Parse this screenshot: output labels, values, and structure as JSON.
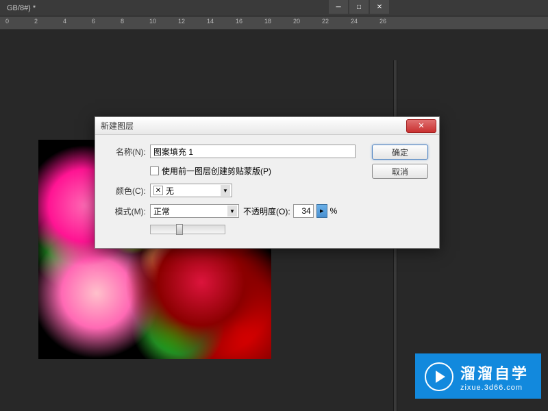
{
  "tab": {
    "label": "GB/8#) *"
  },
  "ruler": {
    "marks": [
      0,
      2,
      4,
      6,
      8,
      10,
      12,
      14,
      16,
      18,
      20,
      22,
      24,
      26
    ]
  },
  "dialog": {
    "title": "新建图层",
    "name_label": "名称(N):",
    "name_value": "图案填充 1",
    "checkbox_label": "使用前一图层创建剪贴蒙版(P)",
    "color_label": "颜色(C):",
    "color_value": "无",
    "mode_label": "模式(M):",
    "mode_value": "正常",
    "opacity_label": "不透明度(O):",
    "opacity_value": "34",
    "opacity_unit": "%",
    "ok_button": "确定",
    "cancel_button": "取消"
  },
  "watermark": {
    "title": "溜溜自学",
    "subtitle": "zixue.3d66.com"
  }
}
